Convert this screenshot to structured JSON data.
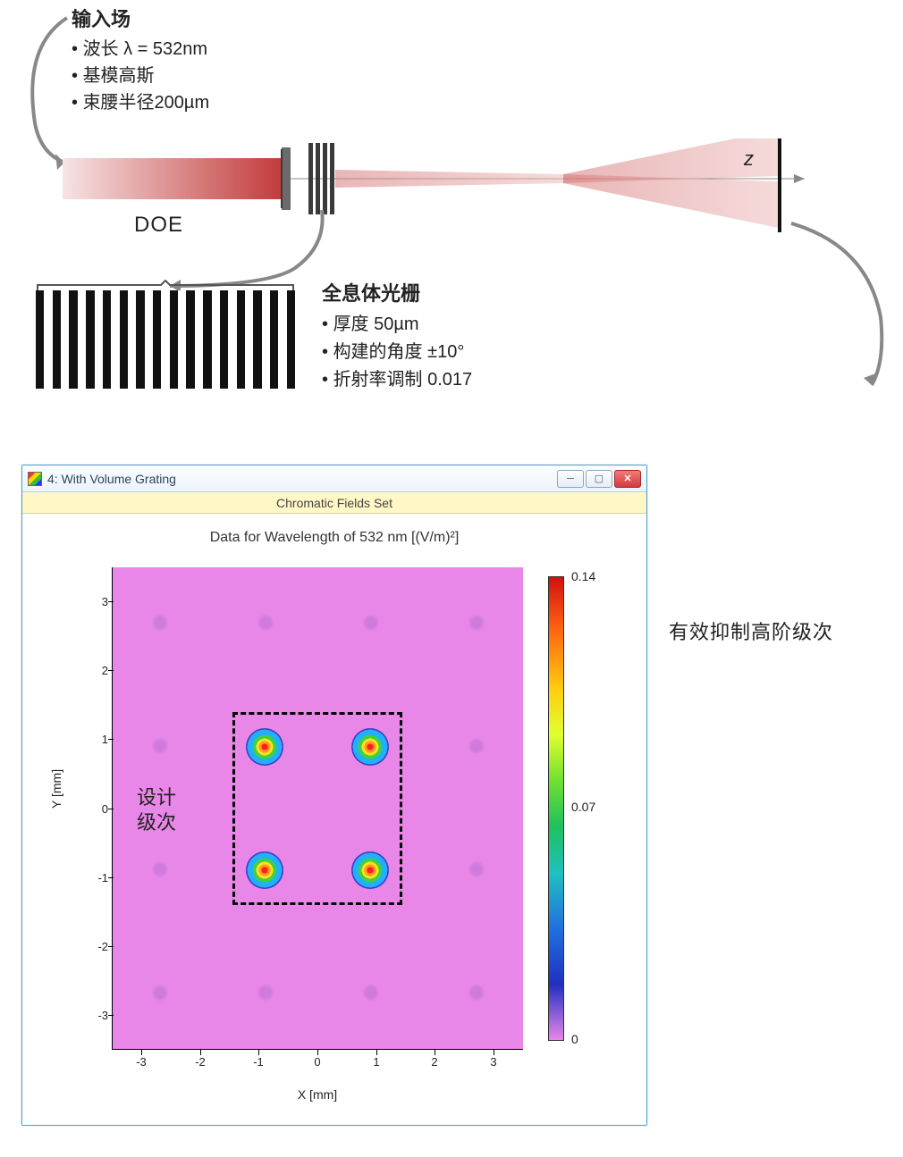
{
  "input_field": {
    "title": "输入场",
    "bullets": [
      "波长 λ = 532nm",
      "基模高斯",
      "束腰半径200µm"
    ]
  },
  "doe_label": "DOE",
  "axis_label_z": "z",
  "grating": {
    "title": "全息体光栅",
    "bullets": [
      "厚度 50µm",
      "构建的角度 ±10°",
      "折射率调制 0.017"
    ]
  },
  "plot": {
    "window_title": "4: With Volume Grating",
    "subtitle": "Chromatic Fields Set",
    "title": "Data for Wavelength of 532 nm  [(V/m)²]",
    "xlabel": "X [mm]",
    "ylabel": "Y [mm]",
    "ticks": [
      "-3",
      "-2",
      "-1",
      "0",
      "1",
      "2",
      "3"
    ],
    "colorbar": {
      "max": "0.14",
      "mid": "0.07",
      "min": "0"
    },
    "design_label_line1": "设计",
    "design_label_line2": "级次"
  },
  "annotation_right": "有效抑制高阶级次",
  "chart_data": {
    "type": "heatmap",
    "title": "Data for Wavelength of 532 nm  [(V/m)²]",
    "xlabel": "X [mm]",
    "ylabel": "Y [mm]",
    "xlim": [
      -3.5,
      3.5
    ],
    "ylim": [
      -3.5,
      3.5
    ],
    "colorbar_range": [
      0,
      0.14
    ],
    "main_spots": [
      {
        "x": -0.9,
        "y": 0.9,
        "peak": 0.14
      },
      {
        "x": 0.9,
        "y": 0.9,
        "peak": 0.14
      },
      {
        "x": -0.9,
        "y": -0.9,
        "peak": 0.14
      },
      {
        "x": 0.9,
        "y": -0.9,
        "peak": 0.14
      }
    ],
    "faint_higher_orders_grid_step_mm": 1.8,
    "design_box": {
      "xmin": -1.2,
      "xmax": 1.2,
      "ymin": -1.2,
      "ymax": 1.2
    }
  }
}
